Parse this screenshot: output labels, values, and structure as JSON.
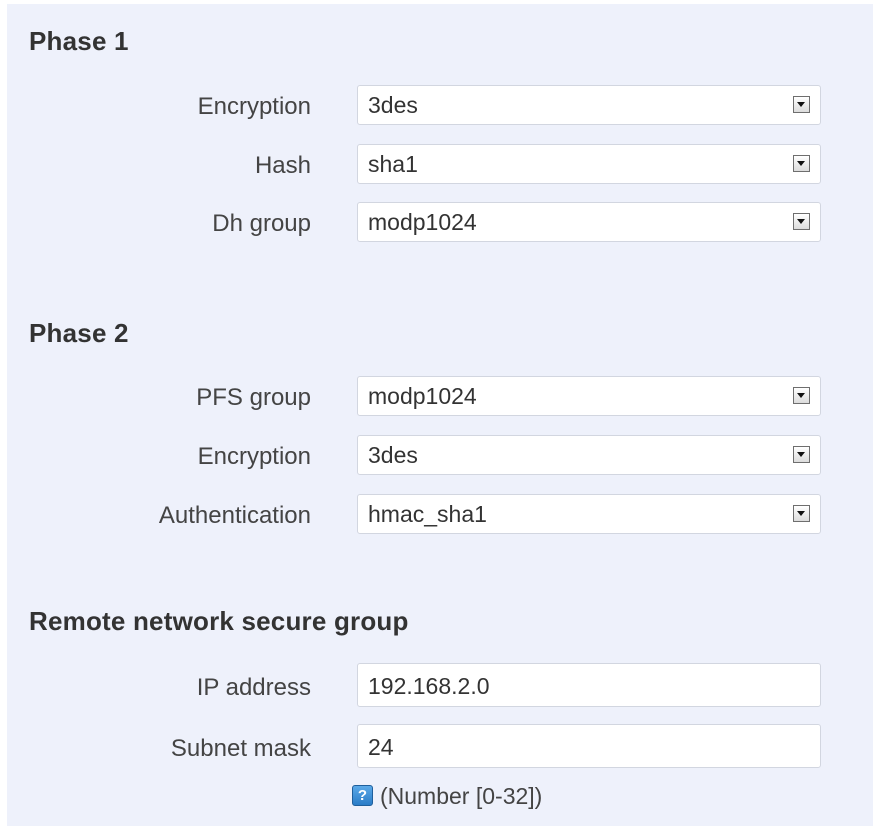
{
  "phase1": {
    "title": "Phase 1",
    "fields": [
      {
        "label": "Encryption",
        "value": "3des"
      },
      {
        "label": "Hash",
        "value": "sha1"
      },
      {
        "label": "Dh group",
        "value": "modp1024"
      }
    ]
  },
  "phase2": {
    "title": "Phase 2",
    "fields": [
      {
        "label": "PFS group",
        "value": "modp1024"
      },
      {
        "label": "Encryption",
        "value": "3des"
      },
      {
        "label": "Authentication",
        "value": "hmac_sha1"
      }
    ]
  },
  "remote": {
    "title": "Remote network secure group",
    "ip_label": "IP address",
    "ip_value": "192.168.2.0",
    "mask_label": "Subnet mask",
    "mask_value": "24",
    "hint_icon": "question-icon",
    "hint_icon_glyph": "?",
    "hint": "(Number [0-32])"
  },
  "colors": {
    "panel_bg": "#eef1fb",
    "help_icon": "#2a7cc7"
  }
}
